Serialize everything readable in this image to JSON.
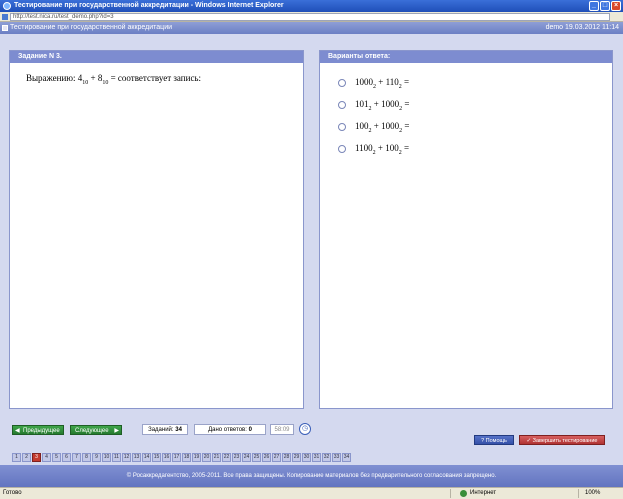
{
  "window": {
    "title": "Тестирование при государственной аккредитации - Windows Internet Explorer",
    "url": "http://test.nica.ru/test_demo.php?id=3",
    "controls": [
      "_",
      "□",
      "×"
    ]
  },
  "appbar": {
    "title": "Тестирование при государственной аккредитации",
    "user_info": "demo  19.03.2012  11:14"
  },
  "question_panel": {
    "header": "Задание N 3.",
    "text_prefix": "Выражению: 4",
    "sub1": "10",
    "text_mid": " + 8",
    "sub2": "10",
    "text_suffix": " =  соответствует запись:"
  },
  "answers_panel": {
    "header": "Варианты ответа:",
    "options": [
      {
        "a": "1000",
        "sa": "2",
        "op": " + 110",
        "sb": "2",
        "eq": " ="
      },
      {
        "a": "101",
        "sa": "2",
        "op": " + 1000",
        "sb": "2",
        "eq": " ="
      },
      {
        "a": "100",
        "sa": "2",
        "op": " + 1000",
        "sb": "2",
        "eq": " ="
      },
      {
        "a": "1100",
        "sa": "2",
        "op": " + 100",
        "sb": "2",
        "eq": " ="
      }
    ]
  },
  "toolbar": {
    "prev_label": "Предыдущее",
    "next_label": "Следующее",
    "tasks_label": "Заданий: ",
    "tasks_count": "34",
    "answers_label": "Дано ответов: ",
    "answers_count": "0",
    "timer": "58:09",
    "help_label": "Помощь",
    "finish_label": "Завершить тестирование"
  },
  "question_numbers": {
    "current": 3,
    "total": 34
  },
  "footer": {
    "text": "© Росаккредагентство, 2005-2011. Все права защищены. Копирование материалов без предварительного согласования запрещено."
  },
  "statusbar": {
    "status": "Готово",
    "zone": "Интернет",
    "zoom": "100%"
  },
  "colors": {
    "panel_header": "#7d8cd0",
    "background": "#d4d9ef",
    "current_question": "#c43a2e",
    "nav_button": "#3fa64a",
    "finish_button": "#b03333"
  }
}
